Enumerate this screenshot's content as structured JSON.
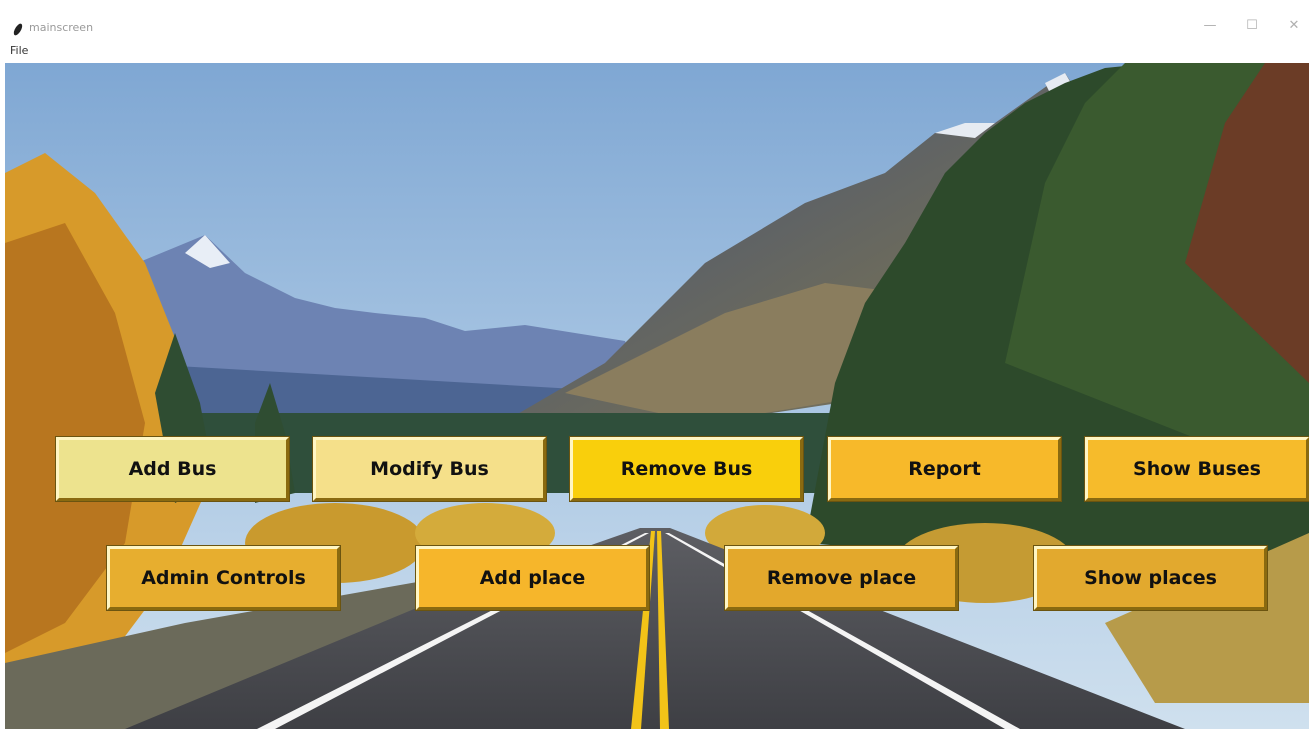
{
  "window": {
    "title": "mainscreen",
    "minimize_glyph": "—",
    "maximize_glyph": "☐",
    "close_glyph": "✕"
  },
  "menu": {
    "file_label": "File"
  },
  "buttons_row1": [
    {
      "label": "Add Bus",
      "color": "#ede38e"
    },
    {
      "label": "Modify Bus",
      "color": "#f5e08a"
    },
    {
      "label": "Remove Bus",
      "color": "#f9cf0c"
    },
    {
      "label": "Report",
      "color": "#f7b92a"
    },
    {
      "label": "Show Buses",
      "color": "#f6bb2b"
    }
  ],
  "buttons_row2": [
    {
      "label": "Admin Controls",
      "color": "#e7ae2f"
    },
    {
      "label": "Add place",
      "color": "#f6b62b"
    },
    {
      "label": "Remove place",
      "color": "#e3a82c"
    },
    {
      "label": "Show places",
      "color": "#e2a92e"
    }
  ]
}
